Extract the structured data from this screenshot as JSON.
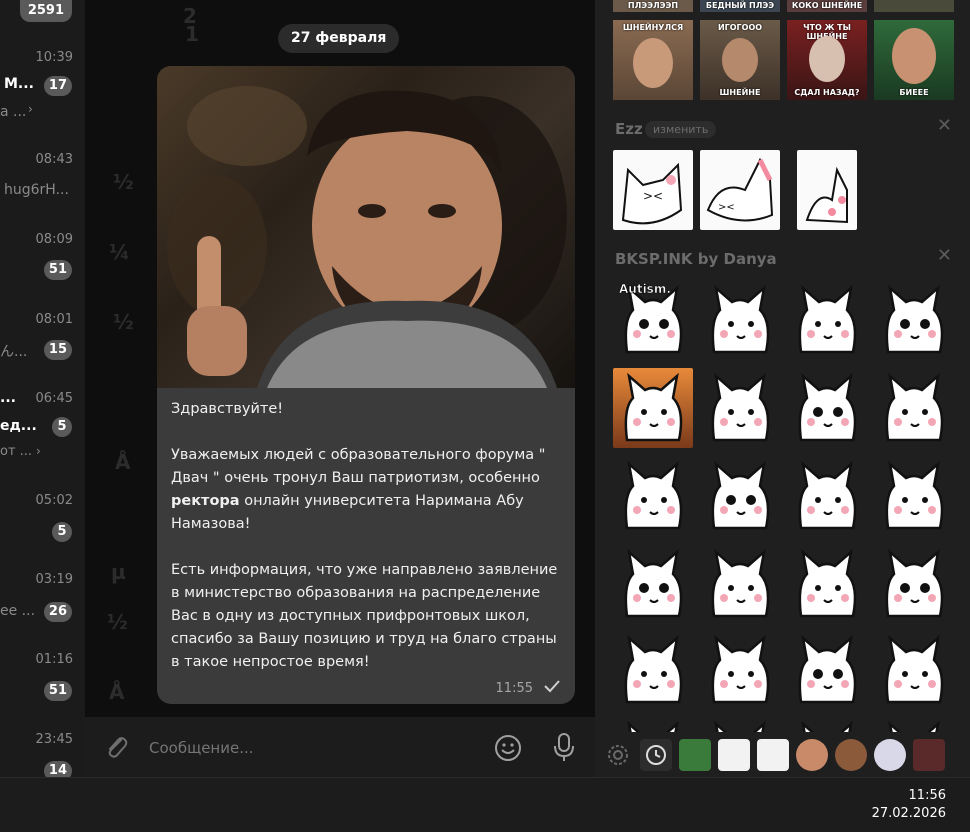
{
  "chat_list": {
    "top_badge": "2591",
    "items": [
      {
        "time": "10:39",
        "title": "М...",
        "badge": "17",
        "snippet": "а ..."
      },
      {
        "time": "08:43",
        "snippet": "hug6rH..."
      },
      {
        "time": "08:09",
        "badge": "51"
      },
      {
        "time": "08:01",
        "snippet": "ん...",
        "badge": "15"
      },
      {
        "time": "06:45",
        "title": "...",
        "snippet_bold": "ед...",
        "badge": "5",
        "snippet": "от ..."
      },
      {
        "time": "05:02",
        "badge": "5"
      },
      {
        "time": "03:19",
        "snippet": "ee ...",
        "badge": "26"
      },
      {
        "time": "01:16",
        "badge": "51"
      },
      {
        "time": "23:45",
        "badge": "14"
      }
    ]
  },
  "chat": {
    "date_pill": "27 февраля",
    "message": {
      "greeting": "Здравствуйте!",
      "p1_a": "Уважаемых людей с образовательного форума \" Двач \" очень тронул Ваш патриотизм, особенно ",
      "p1_bold": "ректора",
      "p1_b": " онлайн университета Наримана Абу Намазова!",
      "p2": "Есть информация, что уже направлено заявление в министерство образования на распределение Вас в одну из доступных прифронтовых школ, спасибо за Вашу позицию и труд на благо страны в такое непростое время!",
      "time": "11:55"
    }
  },
  "composer": {
    "placeholder": "Сообщение..."
  },
  "sticker_panel": {
    "top_captions": [
      "ПЛЭЭЛЭЭП",
      "БЕДНЫЙ ПЛЭЭ",
      "КОКО ШНЕЙНЕ",
      ""
    ],
    "meme_row": [
      {
        "top": "ШНЕЙНУЛСЯ",
        "bottom": ""
      },
      {
        "top": "ИГОГООО",
        "bottom": "ШНЕЙНЕ"
      },
      {
        "top": "ЧТО Ж ТЫ ШНЕЙНЕ",
        "bottom": "СДАЛ НАЗАД?"
      },
      {
        "top": "",
        "bottom": "БИЕЕЕ"
      }
    ],
    "section_ezz": {
      "title": "Ezz",
      "edit": "изменить"
    },
    "section_bksp": {
      "title": "BKSP.INK by Danya",
      "first_sticker_text": "Autism."
    }
  },
  "taskbar": {
    "time": "11:56",
    "date": "27.02.2026"
  },
  "colors": {
    "background": "#0e0e0e",
    "bubble": "#3b3b3b",
    "panel": "#1f1f1f",
    "badge": "#5a5a5a"
  }
}
